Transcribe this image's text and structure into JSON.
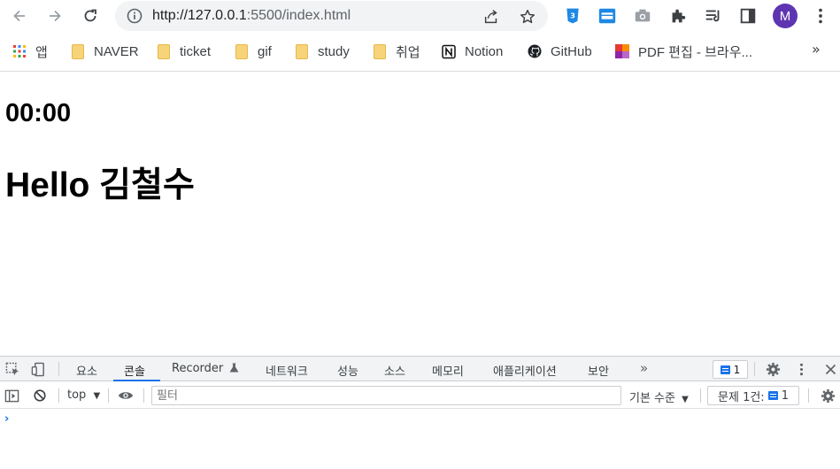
{
  "browser": {
    "url_host": "http://127.0.0.1",
    "url_path": ":5500/index.html",
    "profile_initial": "M"
  },
  "bookmarks": {
    "items": [
      {
        "label": "앱",
        "icon": "apps-grid-icon"
      },
      {
        "label": "NAVER",
        "icon": "folder-icon"
      },
      {
        "label": "ticket",
        "icon": "folder-icon"
      },
      {
        "label": "gif",
        "icon": "folder-icon"
      },
      {
        "label": "study",
        "icon": "folder-icon"
      },
      {
        "label": "취업",
        "icon": "folder-icon"
      },
      {
        "label": "Notion",
        "icon": "notion-icon"
      },
      {
        "label": "GitHub",
        "icon": "github-icon"
      },
      {
        "label": "PDF 편집 - 브라우...",
        "icon": "pdf-app-icon"
      }
    ],
    "more": "»"
  },
  "page": {
    "timer": "00:00",
    "greeting": "Hello 김철수"
  },
  "devtools": {
    "tabs": [
      "요소",
      "콘솔",
      "Recorder",
      "네트워크",
      "성능",
      "소스",
      "메모리",
      "애플리케이션",
      "보안"
    ],
    "active_tab": "콘솔",
    "more_tabs": "»",
    "issue_count": "1",
    "context": "top",
    "filter_placeholder": "필터",
    "levels": "기본 수준",
    "issues_label": "문제 1건:",
    "issues_count": "1",
    "prompt": "›",
    "accent_color": "#1a73e8"
  }
}
